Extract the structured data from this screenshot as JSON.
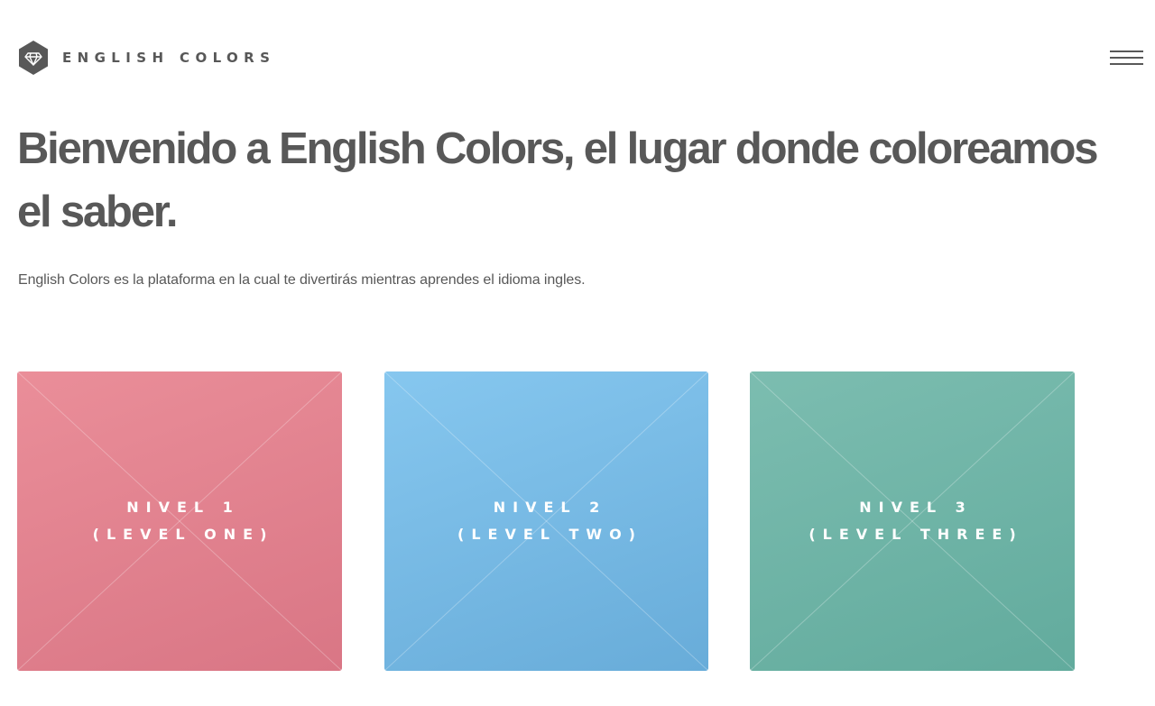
{
  "header": {
    "brand": "ENGLISH COLORS",
    "logo_icon": "diamond-hexagon-icon",
    "menu_icon": "hamburger-menu-icon"
  },
  "hero": {
    "title": "Bienvenido a English Colors, el lugar donde coloreamos el saber.",
    "subtitle": "English Colors es la plataforma en la cual te divertirás mientras aprendes el idioma ingles."
  },
  "levels": [
    {
      "line1": "NIVEL 1",
      "line2": "(LEVEL ONE)",
      "color_light": "#ea8e99",
      "color_dark": "#d97685"
    },
    {
      "line1": "NIVEL 2",
      "line2": "(LEVEL TWO)",
      "color_light": "#86c7ef",
      "color_dark": "#68acd9"
    },
    {
      "line1": "NIVEL 3",
      "line2": "(LEVEL THREE)",
      "color_light": "#7cbdb0",
      "color_dark": "#62ab9d"
    }
  ],
  "colors": {
    "text": "#585858",
    "logo": "#585858"
  }
}
